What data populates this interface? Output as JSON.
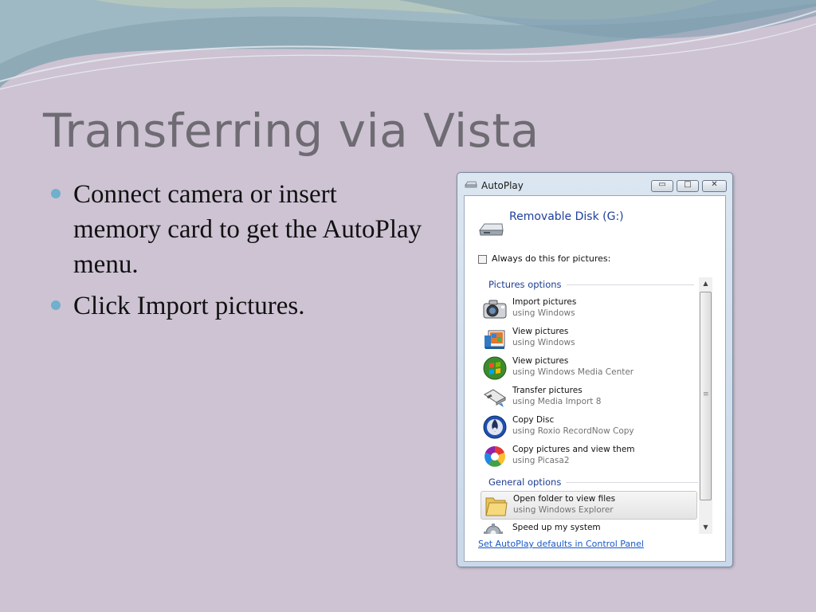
{
  "slide": {
    "title": "Transferring via Vista",
    "bullets": [
      "Connect camera or insert memory card to get the AutoPlay menu.",
      "Click Import pictures."
    ]
  },
  "dialog": {
    "title": "AutoPlay",
    "device_name": "Removable Disk (G:)",
    "always_checkbox_label": "Always do this for pictures:",
    "always_checked": false,
    "pictures_group_label": "Pictures options",
    "general_group_label": "General options",
    "options": [
      {
        "title": "Import pictures",
        "subtitle": "using Windows",
        "icon": "camera-icon"
      },
      {
        "title": "View pictures",
        "subtitle": "using Windows",
        "icon": "photo-gallery-icon"
      },
      {
        "title": "View pictures",
        "subtitle": "using Windows Media Center",
        "icon": "media-center-icon"
      },
      {
        "title": "Transfer pictures",
        "subtitle": "using Media Import 8",
        "icon": "usb-transfer-icon"
      },
      {
        "title": "Copy Disc",
        "subtitle": "using Roxio RecordNow Copy",
        "icon": "roxio-disc-icon"
      },
      {
        "title": "Copy pictures and view them",
        "subtitle": "using Picasa2",
        "icon": "picasa-icon"
      }
    ],
    "general_options": [
      {
        "title": "Open folder to view files",
        "subtitle": "using Windows Explorer",
        "icon": "folder-icon"
      },
      {
        "title": "Speed up my system",
        "subtitle": "",
        "icon": "gear-icon"
      }
    ],
    "footer_link": "Set AutoPlay defaults in Control Panel"
  },
  "colors": {
    "slide_background": "#cdc3d3",
    "title_text": "#6e6b72",
    "bullet_accent": "#6fb0cc",
    "dialog_heading": "#1e3f9c",
    "link": "#1959c7"
  }
}
